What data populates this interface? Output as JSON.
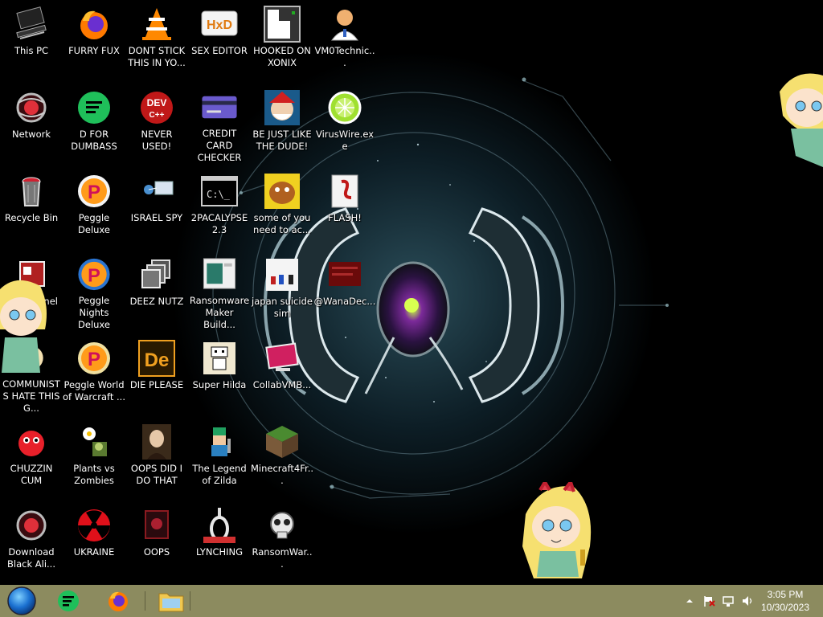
{
  "icons": [
    {
      "label": "This PC"
    },
    {
      "label": "Network"
    },
    {
      "label": "Recycle Bin"
    },
    {
      "label": "Panel"
    },
    {
      "label": "COMMUNISTS HATE THIS G..."
    },
    {
      "label": "CHUZZIN CUM"
    },
    {
      "label": "Download Black Ali..."
    },
    {
      "label": "FURRY FUX"
    },
    {
      "label": "D FOR DUMBASS"
    },
    {
      "label": "Peggle Deluxe"
    },
    {
      "label": "Peggle Nights Deluxe"
    },
    {
      "label": "Peggle World of Warcraft ..."
    },
    {
      "label": "Plants vs Zombies"
    },
    {
      "label": "UKRAINE"
    },
    {
      "label": "DONT STICK THIS IN YO..."
    },
    {
      "label": "NEVER USED!"
    },
    {
      "label": "ISRAEL SPY"
    },
    {
      "label": "DEEZ NUTZ"
    },
    {
      "label": "DIE PLEASE"
    },
    {
      "label": "OOPS DID I DO THAT"
    },
    {
      "label": "OOPS"
    },
    {
      "label": "SEX EDITOR"
    },
    {
      "label": "CREDIT CARD CHECKER"
    },
    {
      "label": "2PACALYPSE 2.3"
    },
    {
      "label": "Ransomware Maker Build..."
    },
    {
      "label": "Super Hilda"
    },
    {
      "label": "The Legend of Zilda"
    },
    {
      "label": "LYNCHING"
    },
    {
      "label": "HOOKED ON XONIX"
    },
    {
      "label": "BE JUST LIKE THE DUDE!"
    },
    {
      "label": "some of you need to ac..."
    },
    {
      "label": "japan suicide sim"
    },
    {
      "label": "CollabVMB..."
    },
    {
      "label": "Minecraft4Fr..."
    },
    {
      "label": "RansomWar..."
    },
    {
      "label": "VM0Technic..."
    },
    {
      "label": "VirusWire.exe"
    },
    {
      "label": "FLASH!"
    },
    {
      "label": "@WanaDec..."
    }
  ],
  "icon_texts": {
    "dev": "DEV",
    "dev_sub": "C++",
    "hxd": "HxD",
    "cmd": "C:\\_",
    "de": "De",
    "peggle": "P"
  },
  "taskbar": {
    "color": "#8c8b5f",
    "clock_time": "3:05 PM",
    "clock_date": "10/30/2023",
    "start_icon": "start-orb-icon",
    "apps": [
      "notes-app-icon",
      "firefox-icon",
      "file-explorer-icon"
    ]
  }
}
